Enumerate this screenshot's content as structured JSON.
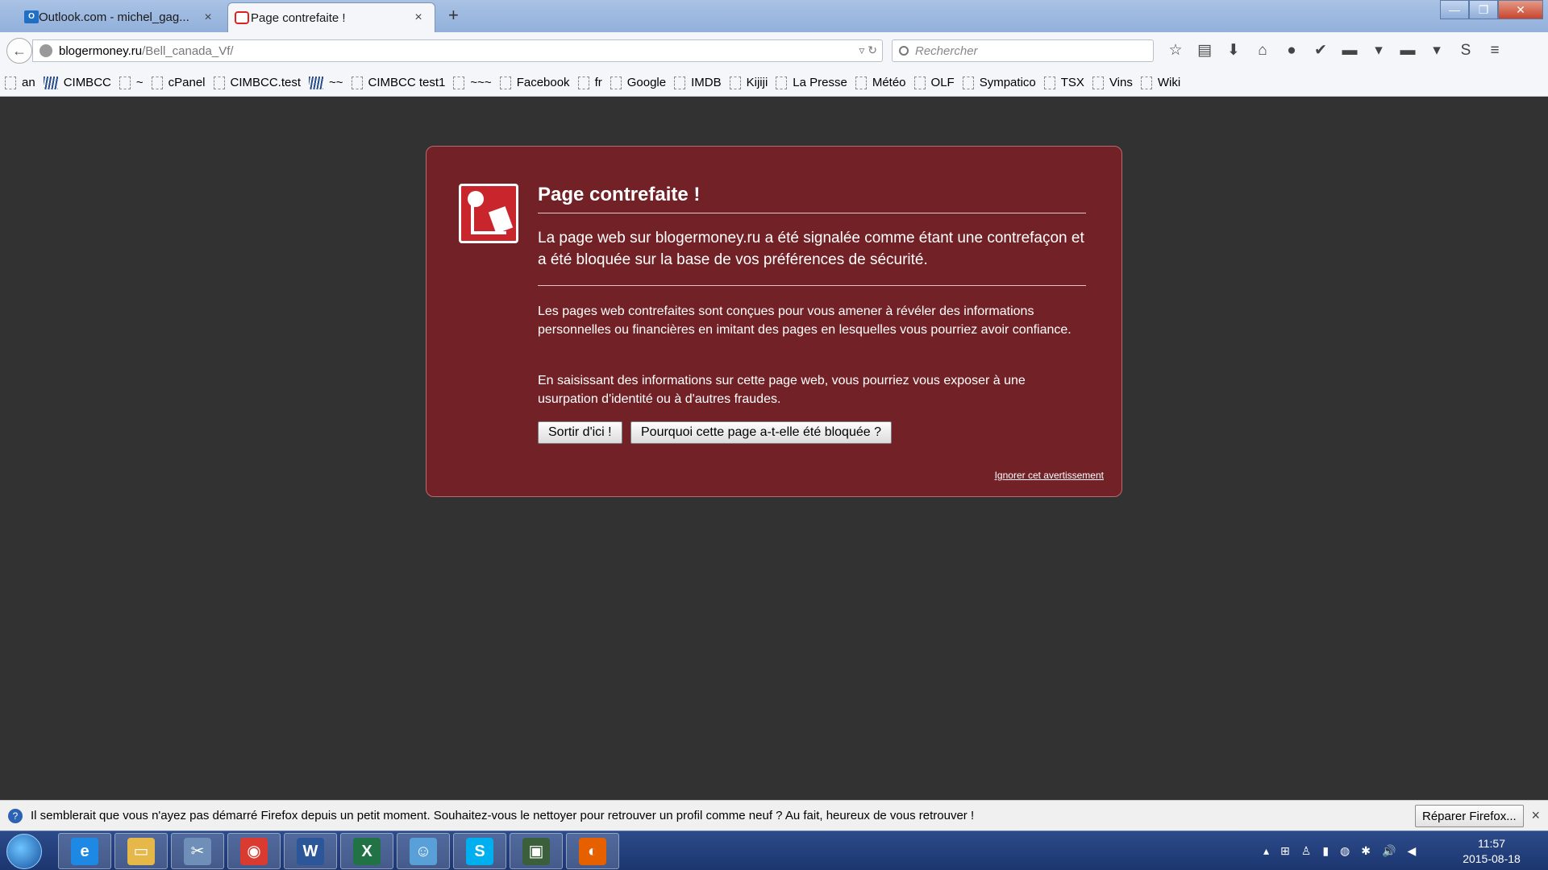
{
  "tabs": [
    {
      "title": "Outlook.com - michel_gag...",
      "icon": "outlook-icon",
      "close": "×"
    },
    {
      "title": "Page contrefaite !",
      "icon": "warning-page-icon",
      "close": "×"
    }
  ],
  "new_tab_label": "+",
  "window_controls": {
    "minimize": "—",
    "maximize": "❐",
    "close": "✕"
  },
  "navbar": {
    "back": "←",
    "url_host": "blogermoney.ru",
    "url_path": "/Bell_canada_Vf/",
    "url_controls": "▿ ↻",
    "search_placeholder": "Rechercher",
    "icons": [
      {
        "name": "bookmark-star-icon",
        "glyph": "☆"
      },
      {
        "name": "reading-list-icon",
        "glyph": "▤"
      },
      {
        "name": "download-icon",
        "glyph": "⬇"
      },
      {
        "name": "home-icon",
        "glyph": "⌂"
      },
      {
        "name": "chat-icon",
        "glyph": "●"
      },
      {
        "name": "checkmark-icon",
        "glyph": "✔"
      },
      {
        "name": "green-addon-icon",
        "glyph": "▬"
      },
      {
        "name": "dropdown-icon",
        "glyph": "▾"
      },
      {
        "name": "yellow-addon-icon",
        "glyph": "▬"
      },
      {
        "name": "dropdown-icon-2",
        "glyph": "▾"
      },
      {
        "name": "skype-icon",
        "glyph": "S"
      },
      {
        "name": "menu-icon",
        "glyph": "≡"
      }
    ]
  },
  "bookmarks": [
    {
      "label": "an",
      "icon": "page"
    },
    {
      "label": "CIMBCC",
      "icon": "wave"
    },
    {
      "label": "~",
      "icon": "page"
    },
    {
      "label": "cPanel",
      "icon": "page"
    },
    {
      "label": "CIMBCC.test",
      "icon": "page"
    },
    {
      "label": "~~",
      "icon": "wave"
    },
    {
      "label": "CIMBCC test1",
      "icon": "page"
    },
    {
      "label": "~~~",
      "icon": "page"
    },
    {
      "label": "Facebook",
      "icon": "page"
    },
    {
      "label": "fr",
      "icon": "page"
    },
    {
      "label": "Google",
      "icon": "page"
    },
    {
      "label": "IMDB",
      "icon": "page"
    },
    {
      "label": "Kijiji",
      "icon": "page"
    },
    {
      "label": "La Presse",
      "icon": "page"
    },
    {
      "label": "Météo",
      "icon": "page"
    },
    {
      "label": "OLF",
      "icon": "page"
    },
    {
      "label": "Sympatico",
      "icon": "page"
    },
    {
      "label": "TSX",
      "icon": "page"
    },
    {
      "label": "Vins",
      "icon": "page"
    },
    {
      "label": "Wiki",
      "icon": "page"
    }
  ],
  "error": {
    "title": "Page contrefaite !",
    "short_desc": "La page web sur blogermoney.ru a été signalée comme étant une contrefaçon et a été bloquée sur la base de vos préférences de sécurité.",
    "para1": "Les pages web contrefaites sont conçues pour vous amener à révéler des informations personnelles ou financières en imitant des pages en lesquelles vous pourriez avoir confiance.",
    "para2": "En saisissant des informations sur cette page web, vous pourriez vous exposer à une usurpation d'identité ou à d'autres fraudes.",
    "btn_leave": "Sortir d'ici !",
    "btn_why": "Pourquoi cette page a-t-elle été bloquée ?",
    "ignore": "Ignorer cet avertissement"
  },
  "notification": {
    "text": "Il semblerait que vous n'ayez pas démarré Firefox depuis un petit moment. Souhaitez-vous le nettoyer pour retrouver un profil comme neuf ? Au fait, heureux de vous retrouver !",
    "button": "Réparer Firefox...",
    "close": "×"
  },
  "taskbar": {
    "apps": [
      {
        "name": "internet-explorer-icon",
        "glyph": "e",
        "color": "#1e88e5"
      },
      {
        "name": "file-explorer-icon",
        "glyph": "▭",
        "color": "#e6b84a"
      },
      {
        "name": "snipping-tool-icon",
        "glyph": "✂",
        "color": "#6f8fb8"
      },
      {
        "name": "chrome-icon",
        "glyph": "◉",
        "color": "#d93b30"
      },
      {
        "name": "word-icon",
        "glyph": "W",
        "color": "#2b579a"
      },
      {
        "name": "excel-icon",
        "glyph": "X",
        "color": "#217346"
      },
      {
        "name": "people-icon",
        "glyph": "☺",
        "color": "#5aa0d8"
      },
      {
        "name": "skype-app-icon",
        "glyph": "S",
        "color": "#00aff0"
      },
      {
        "name": "terminal-icon",
        "glyph": "▣",
        "color": "#3b5f3b"
      },
      {
        "name": "firefox-icon",
        "glyph": "◐",
        "color": "#e66000"
      }
    ],
    "tray_icons": [
      "▴",
      "⊞",
      "♙",
      "▮",
      "◍",
      "✱",
      "🔊",
      "◀"
    ],
    "time": "11:57",
    "date": "2015-08-18"
  }
}
